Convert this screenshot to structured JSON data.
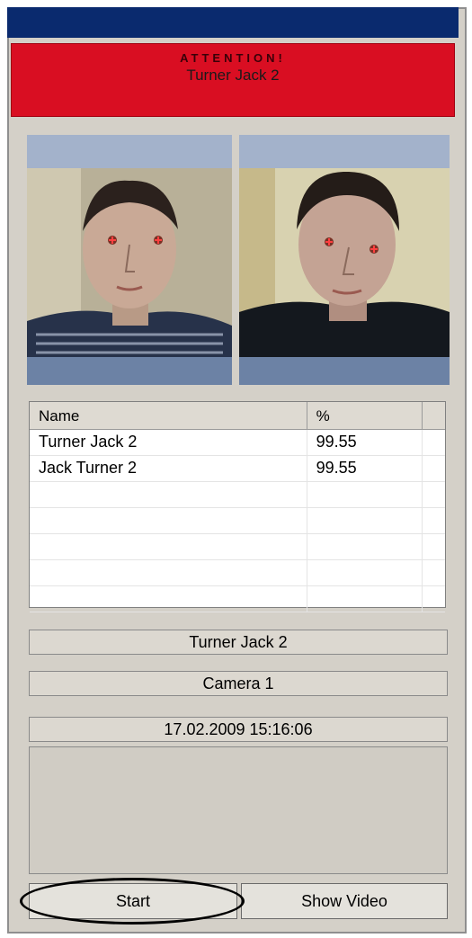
{
  "alert": {
    "heading": "ATTENTION!",
    "person_name": "Turner Jack 2"
  },
  "table": {
    "columns": [
      "Name",
      "%"
    ],
    "rows": [
      {
        "name": "Turner Jack 2",
        "percent": "99.55"
      },
      {
        "name": "Jack Turner 2",
        "percent": "99.55"
      },
      {
        "name": "",
        "percent": ""
      },
      {
        "name": "",
        "percent": ""
      },
      {
        "name": "",
        "percent": ""
      },
      {
        "name": "",
        "percent": ""
      },
      {
        "name": "",
        "percent": ""
      }
    ]
  },
  "details": {
    "recognized_name": "Turner Jack 2",
    "camera": "Camera 1",
    "timestamp": "17.02.2009 15:16:06"
  },
  "buttons": {
    "start": "Start",
    "show_video": "Show Video"
  },
  "colors": {
    "title_bar": "#0a2a6e",
    "alert_background": "#d90e22",
    "photo_frame": "#6c82a5",
    "panel_background": "#d4d0c8"
  }
}
